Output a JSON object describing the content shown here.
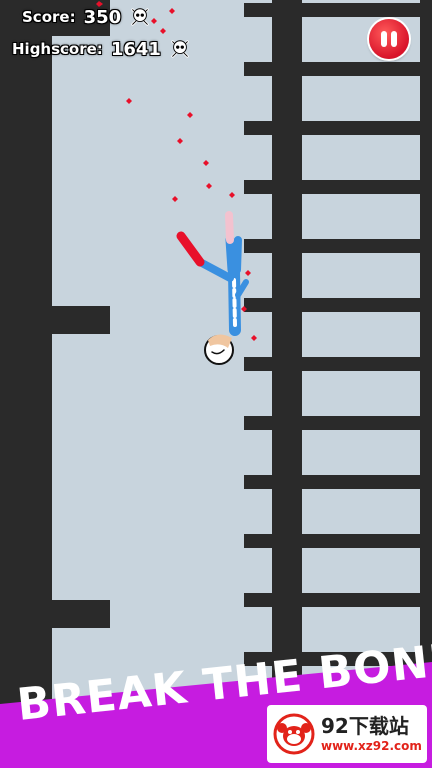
{
  "hud": {
    "score_label": "Score:",
    "score_value": "350",
    "highscore_label": "Highscore:",
    "highscore_value": "1641",
    "skull_icon": "skull-crossbones-icon"
  },
  "controls": {
    "pause_icon": "pause-icon"
  },
  "banner": {
    "text": "BREAK THE BONES",
    "color": "#c61ce0"
  },
  "watermark": {
    "title": "92下载站",
    "url": "www.xz92.com",
    "logo_icon": "monkey-logo-icon"
  },
  "colors": {
    "sky": "#c8d4dd",
    "walls": "#2a2a2a",
    "blood": "#e8102a",
    "suit": "#3a90e0",
    "pause": "#e2182b"
  }
}
